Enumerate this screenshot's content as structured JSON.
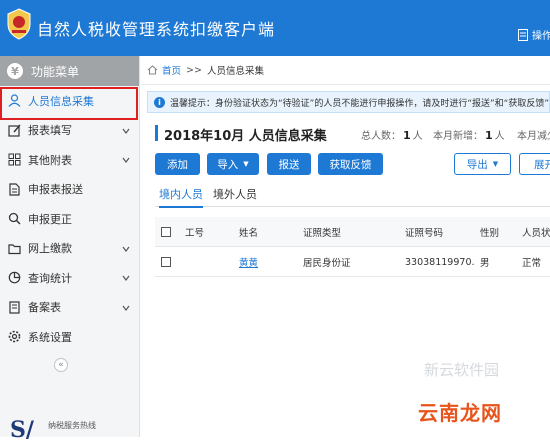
{
  "header": {
    "title": "自然人税收管理系统扣缴客户端",
    "action_label": "操作"
  },
  "sidebar": {
    "heading": "功能菜单",
    "heading_icon": "¥",
    "items": [
      {
        "label": "人员信息采集",
        "icon": "person-icon",
        "active": true
      },
      {
        "label": "报表填写",
        "icon": "edit-icon",
        "has_children": true
      },
      {
        "label": "其他附表",
        "icon": "grid-icon",
        "has_children": true
      },
      {
        "label": "申报表报送",
        "icon": "document-icon"
      },
      {
        "label": "申报更正",
        "icon": "search-icon"
      },
      {
        "label": "网上缴款",
        "icon": "folder-icon",
        "has_children": true
      },
      {
        "label": "查询统计",
        "icon": "chart-icon",
        "has_children": true
      },
      {
        "label": "备案表",
        "icon": "file-icon",
        "has_children": true
      },
      {
        "label": "系统设置",
        "icon": "gear-icon"
      }
    ],
    "collapse_symbol": "«",
    "hotline_label": "纳税服务热线"
  },
  "breadcrumb": {
    "home": "首页",
    "separator": ">>",
    "current": "人员信息采集"
  },
  "tip": {
    "text": "温馨提示：身份验证状态为“待验证”的人员不能进行申报操作，请及时进行“报送”和“获取反馈”"
  },
  "page": {
    "title": "2018年10月  人员信息采集",
    "stats": {
      "total_label": "总人数：",
      "total_value": "1",
      "total_unit": "人",
      "new_label": "本月新增：",
      "new_value": "1",
      "new_unit": "人",
      "reduce_label": "本月减少"
    }
  },
  "toolbar": {
    "add": "添加",
    "import": "导入",
    "submit": "报送",
    "feedback": "获取反馈",
    "export": "导出",
    "expand": "展开"
  },
  "tabs": [
    {
      "label": "境内人员",
      "active": true
    },
    {
      "label": "境外人员",
      "active": false
    }
  ],
  "table": {
    "columns": [
      "工号",
      "姓名",
      "证照类型",
      "证照号码",
      "性别",
      "人员状态"
    ],
    "rows": [
      {
        "id": "",
        "name": "黄黄",
        "id_type": "居民身份证",
        "id_number": "33038119970...",
        "gender": "男",
        "status": "正常"
      }
    ]
  },
  "watermark": {
    "text": "云南龙网",
    "faint_text": "新云软件园"
  },
  "colors": {
    "accent": "#1e79d5",
    "highlight": "#e02020",
    "sidebar_head": "#a1a4a7"
  }
}
